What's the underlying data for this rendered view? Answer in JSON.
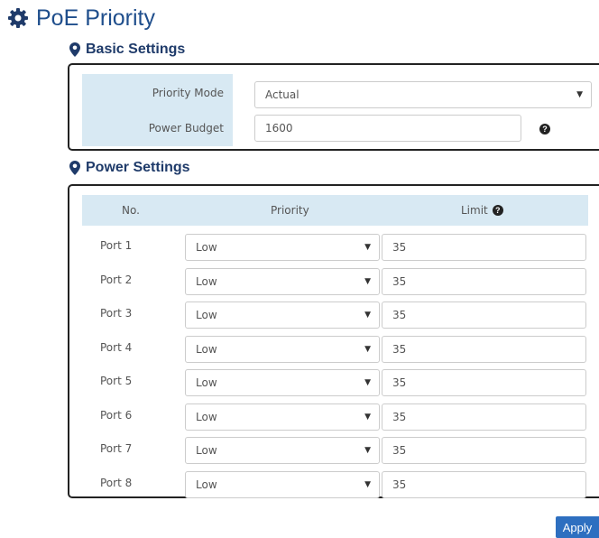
{
  "page": {
    "title": "PoE Priority"
  },
  "basic": {
    "heading": "Basic Settings",
    "priority_mode_label": "Priority Mode",
    "priority_mode_value": "Actual",
    "power_budget_label": "Power Budget",
    "power_budget_value": "1600"
  },
  "power": {
    "heading": "Power Settings",
    "columns": {
      "no": "No.",
      "priority": "Priority",
      "limit": "Limit"
    },
    "ports": [
      {
        "name": "Port 1",
        "priority": "Low",
        "limit": "35"
      },
      {
        "name": "Port 2",
        "priority": "Low",
        "limit": "35"
      },
      {
        "name": "Port 3",
        "priority": "Low",
        "limit": "35"
      },
      {
        "name": "Port 4",
        "priority": "Low",
        "limit": "35"
      },
      {
        "name": "Port 5",
        "priority": "Low",
        "limit": "35"
      },
      {
        "name": "Port 6",
        "priority": "Low",
        "limit": "35"
      },
      {
        "name": "Port 7",
        "priority": "Low",
        "limit": "35"
      },
      {
        "name": "Port 8",
        "priority": "Low",
        "limit": "35"
      }
    ]
  },
  "actions": {
    "apply_label": "Apply"
  },
  "colors": {
    "title": "#1f4e8c",
    "header_bg": "#d8e9f3",
    "apply_bg": "#2e6fc0"
  }
}
